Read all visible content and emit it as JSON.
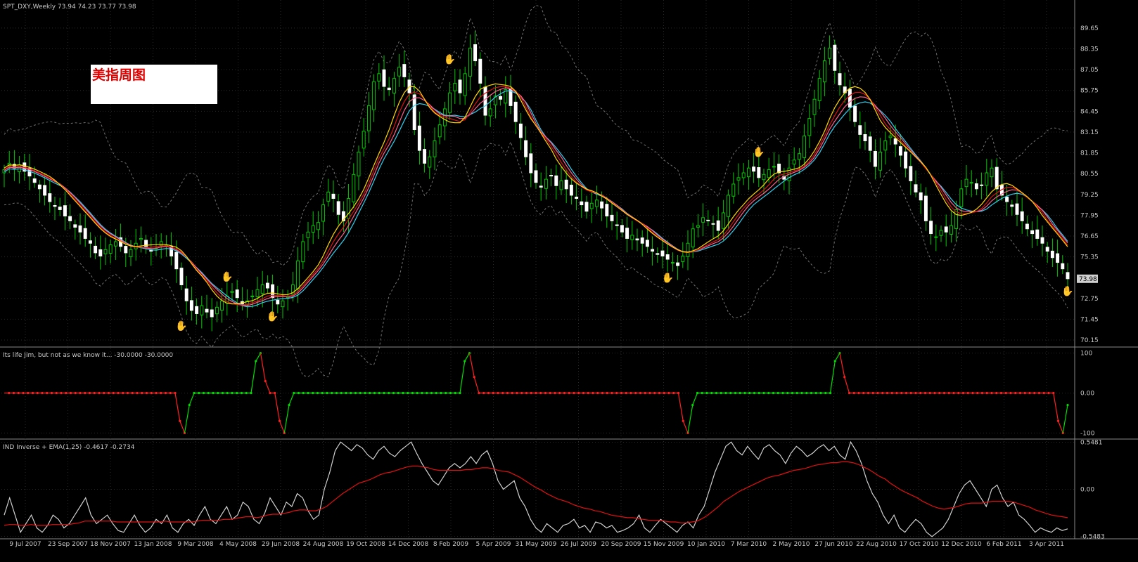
{
  "colors": {
    "background": "#000000",
    "grid": "#2a2a2a",
    "axis_text": "#c8c8c8",
    "bull_candle": "#00c800",
    "bear_candle": "#ffffff",
    "ma_yellow": "#ffd700",
    "ma_red": "#e01010",
    "ma_cyan": "#30d0f0",
    "ma_pink": "#ff6090",
    "band_gray": "#707070",
    "osc_up": "#00e000",
    "osc_down": "#ff2020",
    "inverse_line": "#d0d0d0",
    "ema_line": "#e01010",
    "price_box": "#d0d0d0",
    "annotation_text": "#e00000"
  },
  "annotation": {
    "text": "美指周图"
  },
  "chart_data": [
    {
      "type": "candlestick",
      "title": "SPT_DXY,Weekly",
      "ohlc_header": "73.94 74.23 73.77 73.98",
      "price_tag": "73.98",
      "current_price": 73.98,
      "y_ticks": [
        "89.65",
        "88.35",
        "87.05",
        "85.75",
        "84.45",
        "83.15",
        "81.85",
        "80.55",
        "79.25",
        "77.95",
        "76.65",
        "75.35",
        "72.75",
        "71.45",
        "70.15"
      ],
      "ylim": [
        69.8,
        90.7
      ],
      "x_labels": [
        "9 Jul 2007",
        "23 Sep 2007",
        "18 Nov 2007",
        "13 Jan 2008",
        "9 Mar 2008",
        "4 May 2008",
        "29 Jun 2008",
        "24 Aug 2008",
        "19 Oct 2008",
        "14 Dec 2008",
        "8 Feb 2009",
        "5 Apr 2009",
        "31 May 2009",
        "26 Jul 2009",
        "20 Sep 2009",
        "15 Nov 2009",
        "10 Jan 2010",
        "7 Mar 2010",
        "2 May 2010",
        "27 Jun 2010",
        "22 Aug 2010",
        "17 Oct 2010",
        "12 Dec 2010",
        "6 Feb 2011",
        "3 Apr 2011"
      ],
      "close_series": [
        80.8,
        81.2,
        80.9,
        81.1,
        80.7,
        80.4,
        80.0,
        79.6,
        79.2,
        78.8,
        78.5,
        78.3,
        77.9,
        77.6,
        77.2,
        76.9,
        76.5,
        76.2,
        75.6,
        75.4,
        75.8,
        76.1,
        76.3,
        76.0,
        75.6,
        75.8,
        76.2,
        76.5,
        76.0,
        75.7,
        75.9,
        76.3,
        76.1,
        75.4,
        74.6,
        73.6,
        72.6,
        72.0,
        71.8,
        72.3,
        71.9,
        71.6,
        72.2,
        72.6,
        72.9,
        73.2,
        72.8,
        72.4,
        72.6,
        72.9,
        73.3,
        73.6,
        73.4,
        72.8,
        72.4,
        72.6,
        72.9,
        73.6,
        75.1,
        76.3,
        76.9,
        77.3,
        77.5,
        78.6,
        79.4,
        79.0,
        78.0,
        77.6,
        79.0,
        80.5,
        81.9,
        83.2,
        84.8,
        86.3,
        86.8,
        86.0,
        85.8,
        86.5,
        87.2,
        86.6,
        85.6,
        83.3,
        82.0,
        81.2,
        81.6,
        82.6,
        83.6,
        84.6,
        85.6,
        86.2,
        85.6,
        86.8,
        88.4,
        87.6,
        86.2,
        84.2,
        84.6,
        85.4,
        85.2,
        85.8,
        84.8,
        83.8,
        82.8,
        81.6,
        80.6,
        80.0,
        79.7,
        80.2,
        80.4,
        79.8,
        80.1,
        79.6,
        79.2,
        79.0,
        78.6,
        78.2,
        78.7,
        78.9,
        78.4,
        77.9,
        77.6,
        77.3,
        76.9,
        76.5,
        76.7,
        76.4,
        76.2,
        76.0,
        75.7,
        75.5,
        75.4,
        75.2,
        75.0,
        74.8,
        75.4,
        76.2,
        77.1,
        77.3,
        77.8,
        77.6,
        77.4,
        77.0,
        78.1,
        79.2,
        79.9,
        80.3,
        80.6,
        80.9,
        80.7,
        80.3,
        80.5,
        80.8,
        81.0,
        80.6,
        80.2,
        80.9,
        81.4,
        81.8,
        82.9,
        84.0,
        85.2,
        86.5,
        87.6,
        88.4,
        87.0,
        86.1,
        85.6,
        84.7,
        83.8,
        83.0,
        82.6,
        82.0,
        81.0,
        81.9,
        82.6,
        82.9,
        82.4,
        81.7,
        80.9,
        80.1,
        79.4,
        78.9,
        77.6,
        76.8,
        76.6,
        77.0,
        76.9,
        77.3,
        78.3,
        79.6,
        80.2,
        80.0,
        79.6,
        79.8,
        80.6,
        80.9,
        79.6,
        79.2,
        78.8,
        78.5,
        78.0,
        77.6,
        77.1,
        76.8,
        76.5,
        76.2,
        75.7,
        75.3,
        75.0,
        74.6,
        73.98
      ],
      "series_legend": [
        {
          "name": "ma_yellow"
        },
        {
          "name": "ma_red"
        },
        {
          "name": "ma_cyan"
        },
        {
          "name": "ma_pink"
        },
        {
          "name": "bands"
        }
      ],
      "top_markers": [
        {
          "x": "4 May 2008",
          "kind": "red-hand"
        },
        {
          "x": "8 Feb 2009",
          "kind": "red-hand"
        },
        {
          "x": "7 Mar 2010",
          "kind": "red-hand"
        }
      ],
      "bottom_markers": [
        {
          "x": "9 Mar 2008",
          "kind": "blue-hand"
        },
        {
          "x": "29 Jun 2008",
          "kind": "blue-hand"
        },
        {
          "x": "15 Nov 2009",
          "kind": "blue-hand"
        },
        {
          "x": "3 Apr 2011",
          "kind": "blue-hand"
        }
      ]
    },
    {
      "type": "line",
      "title": "Its life Jim, but not as we know it... -30.0000 -30.0000",
      "y_ticks": [
        "100",
        "0.00",
        "-100"
      ],
      "ylim": [
        -110,
        110
      ],
      "segments_note": "stepwise oscillator between -100 and 100",
      "values": [
        0,
        0,
        0,
        0,
        0,
        0,
        0,
        0,
        0,
        0,
        0,
        0,
        0,
        0,
        0,
        0,
        0,
        0,
        0,
        0,
        0,
        0,
        0,
        0,
        0,
        0,
        0,
        0,
        0,
        0,
        0,
        0,
        0,
        0,
        0,
        0,
        0,
        -70,
        -100,
        -30,
        0,
        0,
        0,
        0,
        0,
        0,
        0,
        0,
        0,
        0,
        0,
        0,
        0,
        80,
        100,
        30,
        0,
        0,
        -70,
        -100,
        -30,
        0,
        0,
        0,
        0,
        0,
        0,
        0,
        0,
        0,
        0,
        0,
        0,
        0,
        0,
        0,
        0,
        0,
        0,
        0,
        0,
        0,
        0,
        0,
        0,
        0,
        0,
        0,
        0,
        0,
        0,
        0,
        0,
        0,
        0,
        0,
        0,
        80,
        100,
        40,
        0,
        0,
        0,
        0,
        0,
        0,
        0,
        0,
        0,
        0,
        0,
        0,
        0,
        0,
        0,
        0,
        0,
        0,
        0,
        0,
        0,
        0,
        0,
        0,
        0,
        0,
        0,
        0,
        0,
        0,
        0,
        0,
        0,
        0,
        0,
        0,
        0,
        0,
        0,
        0,
        0,
        0,
        0,
        -70,
        -100,
        -30,
        0,
        0,
        0,
        0,
        0,
        0,
        0,
        0,
        0,
        0,
        0,
        0,
        0,
        0,
        0,
        0,
        0,
        0,
        0,
        0,
        0,
        0,
        0,
        0,
        0,
        0,
        0,
        0,
        0,
        80,
        100,
        40,
        0,
        0,
        0,
        0,
        0,
        0,
        0,
        0,
        0,
        0,
        0,
        0,
        0,
        0,
        0,
        0,
        0,
        0,
        0,
        0,
        0,
        0,
        0,
        0,
        0,
        0,
        0,
        0,
        0,
        0,
        0,
        0,
        0,
        0,
        0,
        0,
        0,
        0,
        0,
        0,
        0,
        0,
        0,
        0,
        -70,
        -100,
        -30
      ]
    },
    {
      "type": "line",
      "title": "IND Inverse + EMA(1,25) -0.4617 -0.2734",
      "y_ticks": [
        "0.5481",
        "0.00",
        "-0.5483"
      ],
      "ylim": [
        -0.56,
        0.56
      ],
      "series": [
        {
          "name": "inverse",
          "values": [
            -0.3,
            -0.1,
            -0.3,
            -0.5,
            -0.4,
            -0.3,
            -0.45,
            -0.5,
            -0.42,
            -0.3,
            -0.35,
            -0.45,
            -0.4,
            -0.3,
            -0.2,
            -0.1,
            -0.3,
            -0.4,
            -0.35,
            -0.3,
            -0.4,
            -0.48,
            -0.5,
            -0.4,
            -0.3,
            -0.42,
            -0.5,
            -0.45,
            -0.35,
            -0.4,
            -0.3,
            -0.45,
            -0.5,
            -0.4,
            -0.35,
            -0.42,
            -0.3,
            -0.2,
            -0.35,
            -0.4,
            -0.3,
            -0.2,
            -0.35,
            -0.3,
            -0.15,
            -0.2,
            -0.35,
            -0.4,
            -0.28,
            -0.1,
            -0.2,
            -0.3,
            -0.15,
            -0.2,
            -0.05,
            -0.1,
            -0.25,
            -0.35,
            -0.3,
            0.0,
            0.2,
            0.45,
            0.55,
            0.5,
            0.45,
            0.52,
            0.48,
            0.4,
            0.35,
            0.45,
            0.5,
            0.42,
            0.38,
            0.45,
            0.5,
            0.55,
            0.42,
            0.3,
            0.2,
            0.1,
            0.05,
            0.15,
            0.25,
            0.3,
            0.25,
            0.3,
            0.38,
            0.3,
            0.4,
            0.45,
            0.3,
            0.1,
            0.0,
            0.05,
            0.1,
            -0.1,
            -0.2,
            -0.35,
            -0.45,
            -0.5,
            -0.4,
            -0.45,
            -0.5,
            -0.42,
            -0.4,
            -0.35,
            -0.45,
            -0.42,
            -0.5,
            -0.38,
            -0.4,
            -0.45,
            -0.42,
            -0.5,
            -0.48,
            -0.45,
            -0.4,
            -0.3,
            -0.45,
            -0.5,
            -0.42,
            -0.35,
            -0.4,
            -0.45,
            -0.5,
            -0.42,
            -0.38,
            -0.45,
            -0.3,
            -0.2,
            0.0,
            0.2,
            0.35,
            0.5,
            0.55,
            0.45,
            0.4,
            0.5,
            0.42,
            0.35,
            0.48,
            0.52,
            0.45,
            0.4,
            0.3,
            0.42,
            0.5,
            0.45,
            0.38,
            0.42,
            0.48,
            0.52,
            0.45,
            0.5,
            0.4,
            0.35,
            0.55,
            0.45,
            0.3,
            0.1,
            -0.05,
            -0.15,
            -0.3,
            -0.4,
            -0.3,
            -0.45,
            -0.5,
            -0.42,
            -0.35,
            -0.4,
            -0.5,
            -0.55,
            -0.5,
            -0.45,
            -0.35,
            -0.2,
            -0.05,
            0.05,
            0.1,
            0.0,
            -0.1,
            -0.2,
            0.0,
            0.05,
            -0.1,
            -0.2,
            -0.15,
            -0.3,
            -0.35,
            -0.42,
            -0.5,
            -0.45,
            -0.48,
            -0.5,
            -0.45,
            -0.48,
            -0.46
          ]
        },
        {
          "name": "ema",
          "values": [
            -0.42,
            -0.41,
            -0.41,
            -0.42,
            -0.42,
            -0.41,
            -0.42,
            -0.42,
            -0.42,
            -0.41,
            -0.41,
            -0.41,
            -0.41,
            -0.4,
            -0.39,
            -0.37,
            -0.37,
            -0.37,
            -0.37,
            -0.37,
            -0.37,
            -0.38,
            -0.38,
            -0.38,
            -0.38,
            -0.38,
            -0.38,
            -0.38,
            -0.38,
            -0.38,
            -0.37,
            -0.38,
            -0.38,
            -0.38,
            -0.38,
            -0.38,
            -0.37,
            -0.36,
            -0.36,
            -0.36,
            -0.36,
            -0.35,
            -0.35,
            -0.34,
            -0.33,
            -0.32,
            -0.32,
            -0.33,
            -0.32,
            -0.3,
            -0.29,
            -0.29,
            -0.28,
            -0.27,
            -0.25,
            -0.24,
            -0.24,
            -0.25,
            -0.25,
            -0.23,
            -0.2,
            -0.15,
            -0.1,
            -0.05,
            -0.01,
            0.03,
            0.07,
            0.09,
            0.11,
            0.14,
            0.17,
            0.19,
            0.2,
            0.22,
            0.24,
            0.26,
            0.27,
            0.27,
            0.26,
            0.25,
            0.23,
            0.22,
            0.22,
            0.22,
            0.22,
            0.22,
            0.23,
            0.23,
            0.24,
            0.25,
            0.25,
            0.24,
            0.22,
            0.21,
            0.2,
            0.17,
            0.14,
            0.1,
            0.06,
            0.02,
            -0.01,
            -0.05,
            -0.08,
            -0.11,
            -0.13,
            -0.15,
            -0.18,
            -0.2,
            -0.22,
            -0.23,
            -0.25,
            -0.26,
            -0.28,
            -0.3,
            -0.31,
            -0.32,
            -0.33,
            -0.33,
            -0.34,
            -0.35,
            -0.36,
            -0.36,
            -0.36,
            -0.37,
            -0.38,
            -0.38,
            -0.39,
            -0.39,
            -0.38,
            -0.37,
            -0.34,
            -0.3,
            -0.25,
            -0.2,
            -0.14,
            -0.1,
            -0.06,
            -0.02,
            0.01,
            0.04,
            0.07,
            0.1,
            0.13,
            0.15,
            0.16,
            0.18,
            0.2,
            0.22,
            0.23,
            0.24,
            0.26,
            0.28,
            0.29,
            0.3,
            0.31,
            0.31,
            0.32,
            0.32,
            0.31,
            0.29,
            0.26,
            0.23,
            0.19,
            0.15,
            0.12,
            0.07,
            0.03,
            -0.01,
            -0.04,
            -0.07,
            -0.1,
            -0.14,
            -0.17,
            -0.2,
            -0.22,
            -0.23,
            -0.22,
            -0.21,
            -0.19,
            -0.17,
            -0.16,
            -0.16,
            -0.16,
            -0.15,
            -0.14,
            -0.14,
            -0.14,
            -0.14,
            -0.15,
            -0.17,
            -0.19,
            -0.21,
            -0.24,
            -0.26,
            -0.28,
            -0.3,
            -0.31,
            -0.32,
            -0.33
          ]
        }
      ]
    }
  ]
}
